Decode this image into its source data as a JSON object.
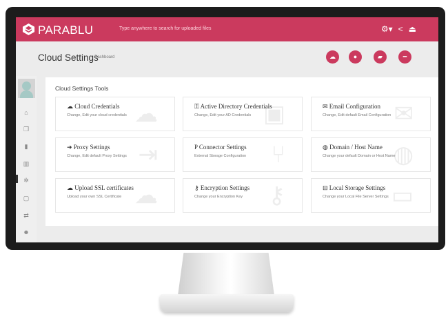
{
  "app": {
    "brand": "PARABLU",
    "search_hint": "Type anywhere to search for uploaded files"
  },
  "topbar_icons": [
    {
      "name": "settings-icon",
      "glyph": "⚙▾"
    },
    {
      "name": "share-icon",
      "glyph": "<"
    },
    {
      "name": "logout-icon",
      "glyph": "⏏"
    }
  ],
  "header": {
    "title": "Cloud Settings",
    "breadcrumb": "Dashboard"
  },
  "header_buttons": [
    {
      "name": "cloud-upload-button",
      "glyph": "☁"
    },
    {
      "name": "user-button",
      "glyph": "●"
    },
    {
      "name": "folder-button",
      "glyph": "▰"
    },
    {
      "name": "remove-button",
      "glyph": "━"
    }
  ],
  "sidebar": {
    "items": [
      {
        "name": "home-icon",
        "glyph": "⌂"
      },
      {
        "name": "copy-icon",
        "glyph": "❐"
      },
      {
        "name": "trash-icon",
        "glyph": "▮"
      },
      {
        "name": "chart-icon",
        "glyph": "▥"
      },
      {
        "name": "settings-icon",
        "glyph": "✲"
      },
      {
        "name": "file-icon",
        "glyph": "▢"
      },
      {
        "name": "transfer-icon",
        "glyph": "⇄"
      },
      {
        "name": "users-icon",
        "glyph": "☻"
      }
    ]
  },
  "panel": {
    "title": "Cloud Settings Tools"
  },
  "cards": [
    {
      "icon": "☁",
      "title": "Cloud Credentials",
      "desc": "Change, Edit your cloud credentials",
      "ghost": "☁"
    },
    {
      "icon": "⚿",
      "title": "Active Directory Credentials",
      "desc": "Change, Edit your AD Credentials",
      "ghost": "▣"
    },
    {
      "icon": "✉",
      "title": "Email Configuration",
      "desc": "Change, Edit default Email Configuration",
      "ghost": "✉"
    },
    {
      "icon": "➜",
      "title": "Proxy Settings",
      "desc": "Change, Edit default Proxy Settings",
      "ghost": "⇥"
    },
    {
      "icon": "P",
      "title": "Connector Settings",
      "desc": "External Storage Configuration",
      "ghost": "⑂"
    },
    {
      "icon": "◍",
      "title": "Domain / Host Name",
      "desc": "Change your default Domain or Host Name",
      "ghost": "◍"
    },
    {
      "icon": "☁",
      "title": "Upload SSL certificates",
      "desc": "Upload your own SSL Certificate",
      "ghost": "☁"
    },
    {
      "icon": "⚷",
      "title": "Encryption Settings",
      "desc": "Change your Encryption Key",
      "ghost": "⚷"
    },
    {
      "icon": "⊟",
      "title": "Local Storage Settings",
      "desc": "Change your Local File Server Settings",
      "ghost": "▭"
    }
  ],
  "colors": {
    "brand": "#cb3a5e",
    "bezel": "#1c1c1c"
  }
}
